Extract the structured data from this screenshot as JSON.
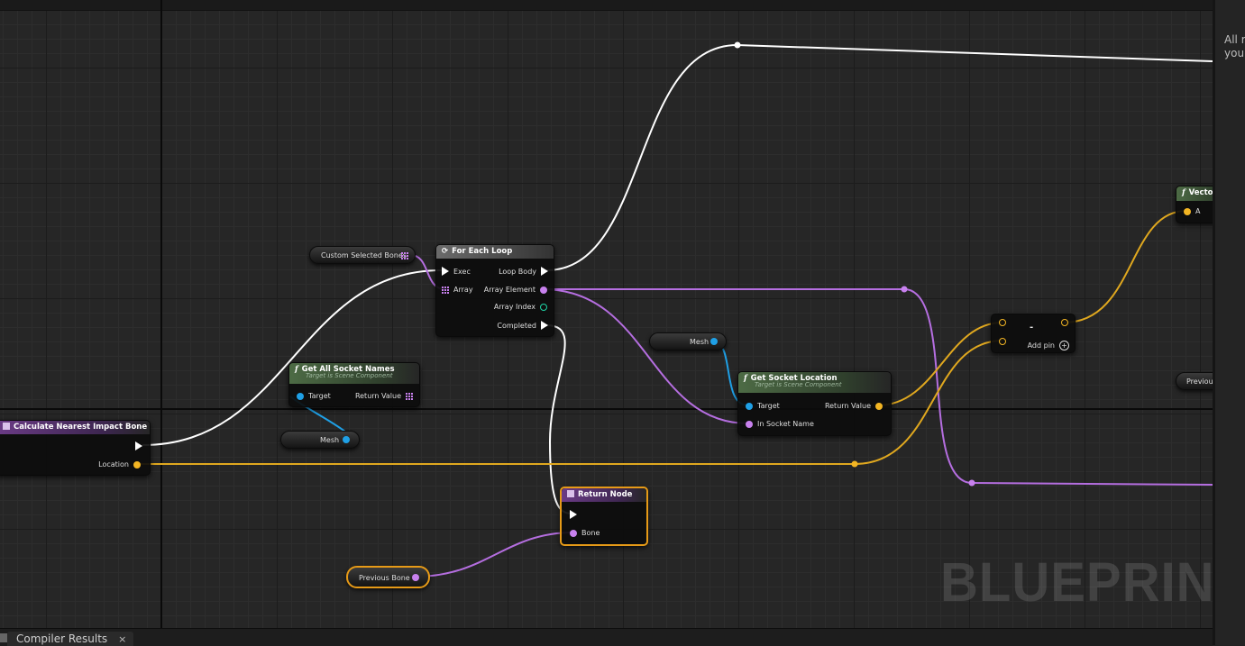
{
  "watermark": "BLUEPRINT",
  "nodes": {
    "calc": {
      "title": "Calculate Nearest Impact Bone",
      "location_label": "Location"
    },
    "get_socket_names": {
      "title": "Get All Socket Names",
      "subtitle": "Target is Scene Component",
      "target_label": "Target",
      "return_label": "Return Value"
    },
    "foreach": {
      "title": "For Each Loop",
      "exec_label": "Exec",
      "array_label": "Array",
      "loop_body_label": "Loop Body",
      "array_element_label": "Array Element",
      "array_index_label": "Array Index",
      "completed_label": "Completed"
    },
    "get_socket_location": {
      "title": "Get Socket Location",
      "subtitle": "Target is Scene Component",
      "target_label": "Target",
      "socket_name_label": "In Socket Name",
      "return_label": "Return Value"
    },
    "add": {
      "symbol": "-",
      "add_pin_label": "Add pin"
    },
    "return_node": {
      "title": "Return Node",
      "bone_label": "Bone"
    },
    "vector_partial": {
      "title": "Vecto",
      "a_label": "A"
    },
    "previous_partial": {
      "label": "Previou"
    }
  },
  "variables": {
    "custom_selected_bones": "Custom Selected Bones",
    "mesh_1": "Mesh",
    "mesh_2": "Mesh",
    "previous_bone": "Previous Bone"
  },
  "right_panel": {
    "line1": "All r",
    "line2": "your"
  },
  "bottom_tab": {
    "label": "Compiler Results",
    "close": "×"
  },
  "colors": {
    "exec": "#ffffff",
    "vector": "#f3b523",
    "name": "#c881ee",
    "object": "#1fa0e6",
    "int": "#1fd6a6",
    "selection": "#e69a17"
  }
}
